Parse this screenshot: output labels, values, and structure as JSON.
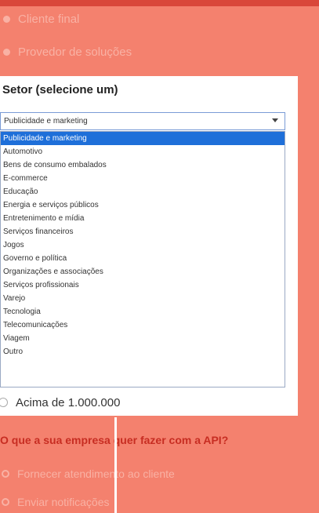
{
  "background_options": [
    "Cliente final",
    "Provedor de soluções"
  ],
  "card": {
    "title": "Setor (selecione um)",
    "select_value": "Publicidade e marketing",
    "options": [
      "Publicidade e marketing",
      "Automotivo",
      "Bens de consumo embalados",
      "E-commerce",
      "Educação",
      "Energia e serviços públicos",
      "Entretenimento e mídia",
      "Serviços financeiros",
      "Jogos",
      "Governo e política",
      "Organizações e associações",
      "Serviços profissionais",
      "Varejo",
      "Tecnologia",
      "Telecomunicações",
      "Viagem",
      "Outro"
    ],
    "selected_index": 0
  },
  "below_option": "Acima de 1.000.000",
  "question": "O que a sua empresa quer fazer com a API?",
  "api_options": [
    "Fornecer atendimento ao cliente",
    "Enviar notificações"
  ],
  "colors": {
    "background": "#f4816e",
    "accent": "#d9473a",
    "selected": "#1e6fd9"
  }
}
